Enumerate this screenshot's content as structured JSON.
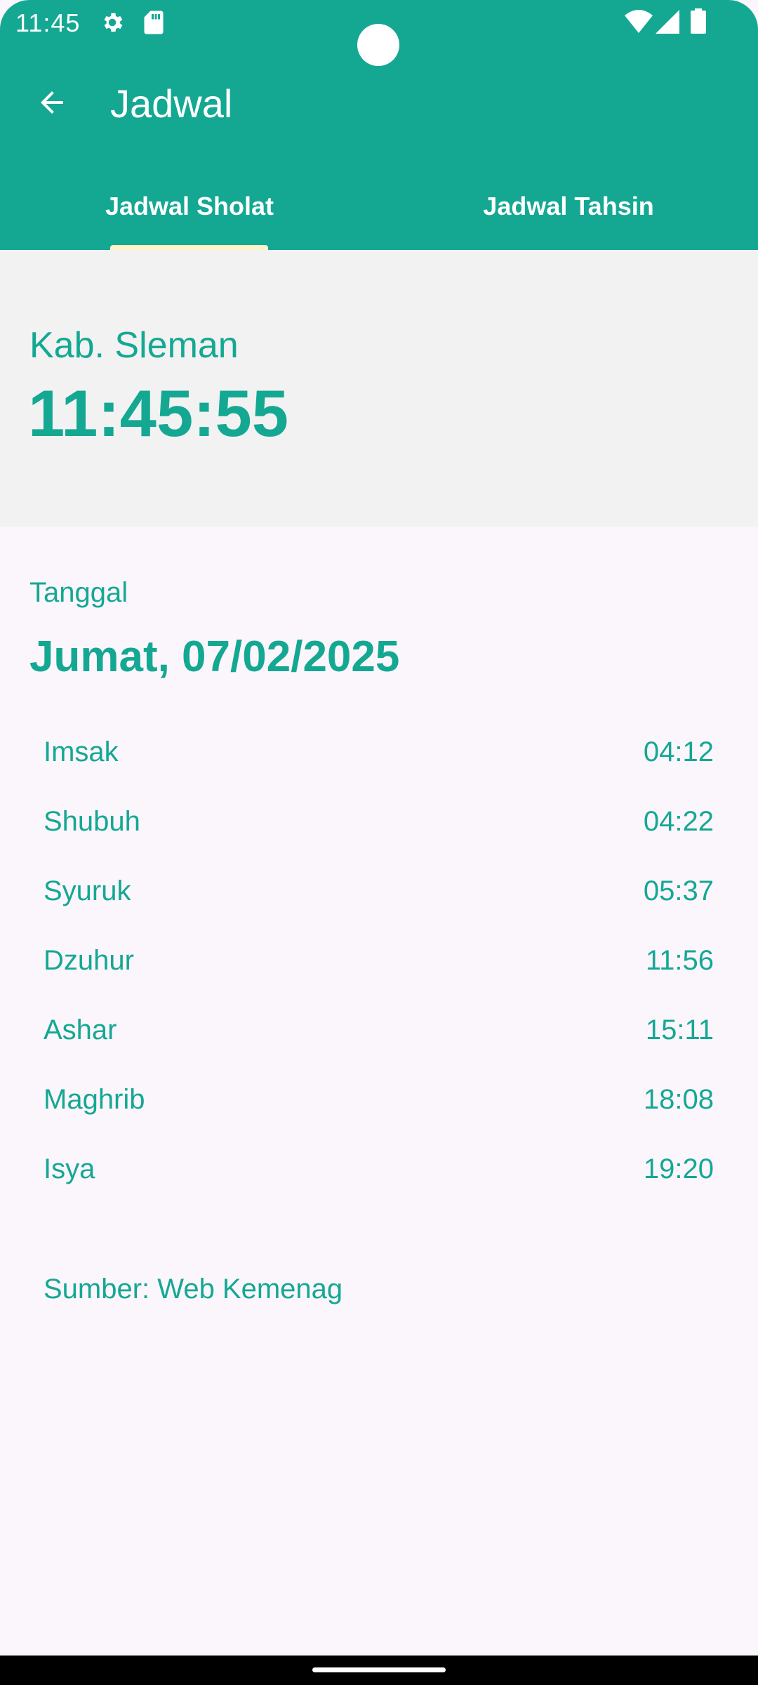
{
  "status_bar": {
    "time": "11:45",
    "icons": [
      "settings-gear-icon",
      "sd-card-icon",
      "wifi-icon",
      "cell-signal-icon",
      "battery-icon"
    ]
  },
  "app_bar": {
    "title": "Jadwal",
    "back_icon": "arrow-left-icon",
    "background_color": "#14A893"
  },
  "tabs": [
    {
      "label": "Jadwal Sholat",
      "selected": true
    },
    {
      "label": "Jadwal Tahsin",
      "selected": false
    }
  ],
  "location": {
    "name": "Kab. Sleman",
    "clock": "11:45:55"
  },
  "date": {
    "label": "Tanggal",
    "value": "Jumat, 07/02/2025"
  },
  "prayers": [
    {
      "name": "Imsak",
      "time": "04:12"
    },
    {
      "name": "Shubuh",
      "time": "04:22"
    },
    {
      "name": "Syuruk",
      "time": "05:37"
    },
    {
      "name": "Dzuhur",
      "time": "11:56"
    },
    {
      "name": "Ashar",
      "time": "15:11"
    },
    {
      "name": "Maghrib",
      "time": "18:08"
    },
    {
      "name": "Isya",
      "time": "19:20"
    }
  ],
  "source": "Sumber: Web Kemenag",
  "colors": {
    "accent": "#14A893",
    "tab_indicator": "#FFF3C9",
    "page_background": "#FBF5FC",
    "panel_background": "#F2F2F2"
  }
}
